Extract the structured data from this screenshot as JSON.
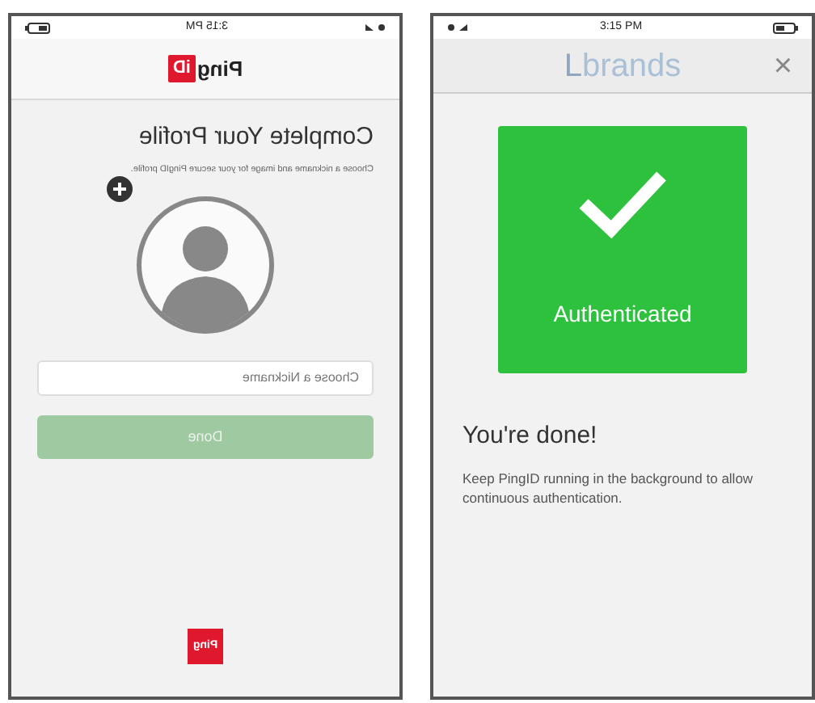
{
  "screens": [
    {
      "kind": "profile",
      "mirrored": true,
      "status_bar": {
        "time": "3:15 PM"
      },
      "logo": {
        "word": "Ping",
        "badge": "iD"
      },
      "title": "Complete Your Profile",
      "subtitle": "Choose a nickname and image for your secure PingID profile.",
      "nickname_field": {
        "placeholder": "Choose a Nickname"
      },
      "done_button": {
        "label": "Done",
        "disabled": true
      },
      "footer_logo": {
        "word": "Ping"
      }
    },
    {
      "kind": "done",
      "mirrored": false,
      "status_bar": {
        "time": "3:15 PM"
      },
      "header": {
        "brand_initial": "L",
        "brand": "brands",
        "close": "×"
      },
      "status_card": {
        "label": "Authenticated"
      },
      "heading": "You're done!",
      "body": "Keep PingID running in the background to allow continuous authentication."
    }
  ]
}
